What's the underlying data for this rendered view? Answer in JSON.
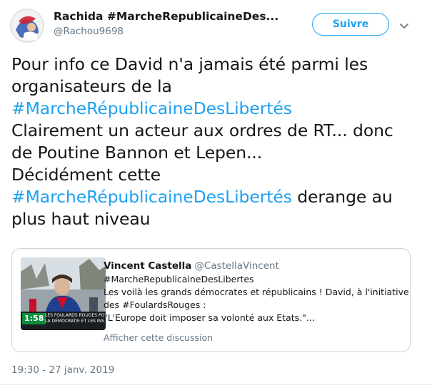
{
  "header": {
    "display_name": "Rachida #MarcheRepublicaineDes...",
    "handle": "@Rachou9698",
    "follow_label": "Suivre",
    "menu_icon": "chevron-down-icon"
  },
  "tweet": {
    "lines": [
      [
        {
          "text": "Pour info ce David n'a jamais été parmi les",
          "hashtag": false
        }
      ],
      [
        {
          "text": "organisateurs de la",
          "hashtag": false
        }
      ],
      [
        {
          "text": "#MarcheRépublicaineDesLibertés",
          "hashtag": true
        }
      ],
      [
        {
          "text": "Clairement un acteur aux ordres de RT... donc",
          "hashtag": false
        }
      ],
      [
        {
          "text": "de Poutine Bannon et Lepen...",
          "hashtag": false
        }
      ],
      [
        {
          "text": "Décidément cette",
          "hashtag": false
        }
      ],
      [
        {
          "text": "#MarcheRépublicaineDesLibertés",
          "hashtag": true
        },
        {
          "text": " derange au",
          "hashtag": false
        }
      ],
      [
        {
          "text": "plus haut niveau",
          "hashtag": false
        }
      ]
    ]
  },
  "quote": {
    "name": "Vincent Castella",
    "handle": "@CastellaVincent",
    "lines": [
      "#MarcheRepublicaineDesLibertes",
      "Les voilà les grands démocrates et républicains ! David, à l'initiative",
      "des #FoulardsRouges :",
      "\"L'Europe doit imposer sa volonté aux Etats.\"..."
    ],
    "show_thread": "Afficher cette discussion",
    "thumbnail": {
      "time": "1:58",
      "banner_lines": [
        "LES FOULARDS ROUGES POU",
        "LA DÉMOCRATIE ET LES INS"
      ]
    }
  },
  "timestamp": "19:30 - 27 janv. 2019",
  "colors": {
    "link": "#1da1f2",
    "text": "#14171a",
    "muted": "#657786",
    "border": "#ccd6dd"
  }
}
